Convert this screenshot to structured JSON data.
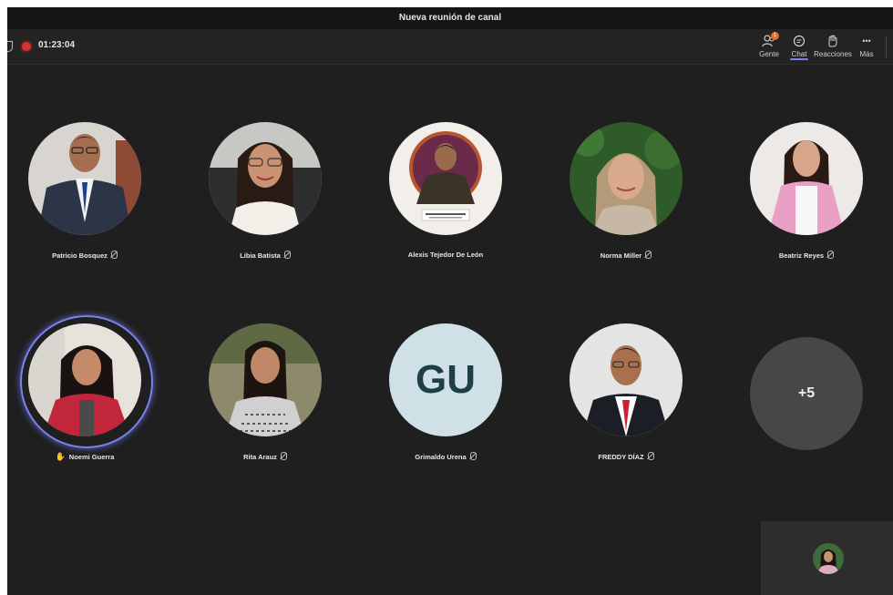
{
  "window": {
    "title": "Nueva reunión de canal"
  },
  "toolbar": {
    "timer": "01:23:04",
    "people": {
      "label": "Gente",
      "badge": "1"
    },
    "chat": {
      "label": "Chat"
    },
    "reactions": {
      "label": "Reacciones"
    },
    "more": {
      "label": "Más",
      "glyph": "•••"
    }
  },
  "participants": [
    {
      "name": "Patricio Bosquez",
      "muted": true
    },
    {
      "name": "Libia Batista",
      "muted": true
    },
    {
      "name": "Alexis Tejedor De León",
      "muted": false
    },
    {
      "name": "Norma Miller",
      "muted": true
    },
    {
      "name": "Beatriz Reyes",
      "muted": true
    },
    {
      "name": "Noemi Guerra",
      "hand_raised": true
    },
    {
      "name": "Rita Arauz",
      "muted": true
    },
    {
      "name": "Grimaldo Urena",
      "initials": "GU",
      "muted": true
    },
    {
      "name": "FREDDY DÍAZ",
      "muted": true
    }
  ],
  "overflow": {
    "label": "+5"
  },
  "colors": {
    "accent": "#7b83eb",
    "background": "#1f1f1f",
    "recording": "#d13438"
  }
}
